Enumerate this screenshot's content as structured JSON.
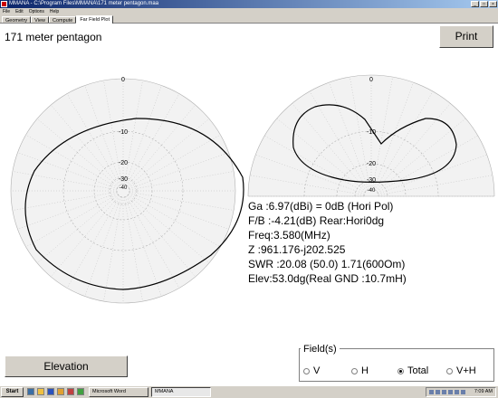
{
  "window": {
    "title": "MMANA - C:\\Program Files\\MMANA\\171 meter pentagon.maa",
    "controls": [
      "_",
      "□",
      "×"
    ]
  },
  "menu": [
    "File",
    "Edit",
    "Options",
    "Help"
  ],
  "tabs": [
    {
      "label": "Geometry",
      "active": false
    },
    {
      "label": "View",
      "active": false
    },
    {
      "label": "Compute",
      "active": false
    },
    {
      "label": "Far Field Plot",
      "active": true
    }
  ],
  "plot_title": "171 meter pentagon",
  "print_label": "Print",
  "left_plot": {
    "ring_labels": [
      "0",
      "-10",
      "-20",
      "-30",
      "-40"
    ]
  },
  "right_plot": {
    "ring_labels": [
      "0",
      "-10",
      "-20",
      "-30",
      "-40"
    ]
  },
  "results": {
    "gain": "Ga  :6.97(dBi) = 0dB  (Hori Pol)",
    "fb": "F/B :-4.21(dB) Rear:Hori0dg",
    "freq": "Freq:3.580(MHz)",
    "z": "Z    :961.176-j202.525",
    "swr": "SWR :20.08 (50.0)  1.71(600Om)",
    "elev": "Elev:53.0dg(Real GND :10.7mH)"
  },
  "elevation_label": "Elevation",
  "field": {
    "legend": "Field(s)",
    "options": [
      {
        "label": "V",
        "checked": false
      },
      {
        "label": "H",
        "checked": false
      },
      {
        "label": "Total",
        "checked": true
      },
      {
        "label": "V+H",
        "checked": false
      }
    ]
  },
  "taskbar": {
    "start_label": "Start",
    "tasks": [
      {
        "label": "Microsoft Word",
        "active": false
      },
      {
        "label": "MMANA",
        "active": true
      }
    ],
    "clock": "7:09 AM"
  },
  "colors": {
    "title_bar": "#0a246a",
    "chrome": "#d4d0c8",
    "grid": "#b0b0b0",
    "pattern": "#000000"
  }
}
